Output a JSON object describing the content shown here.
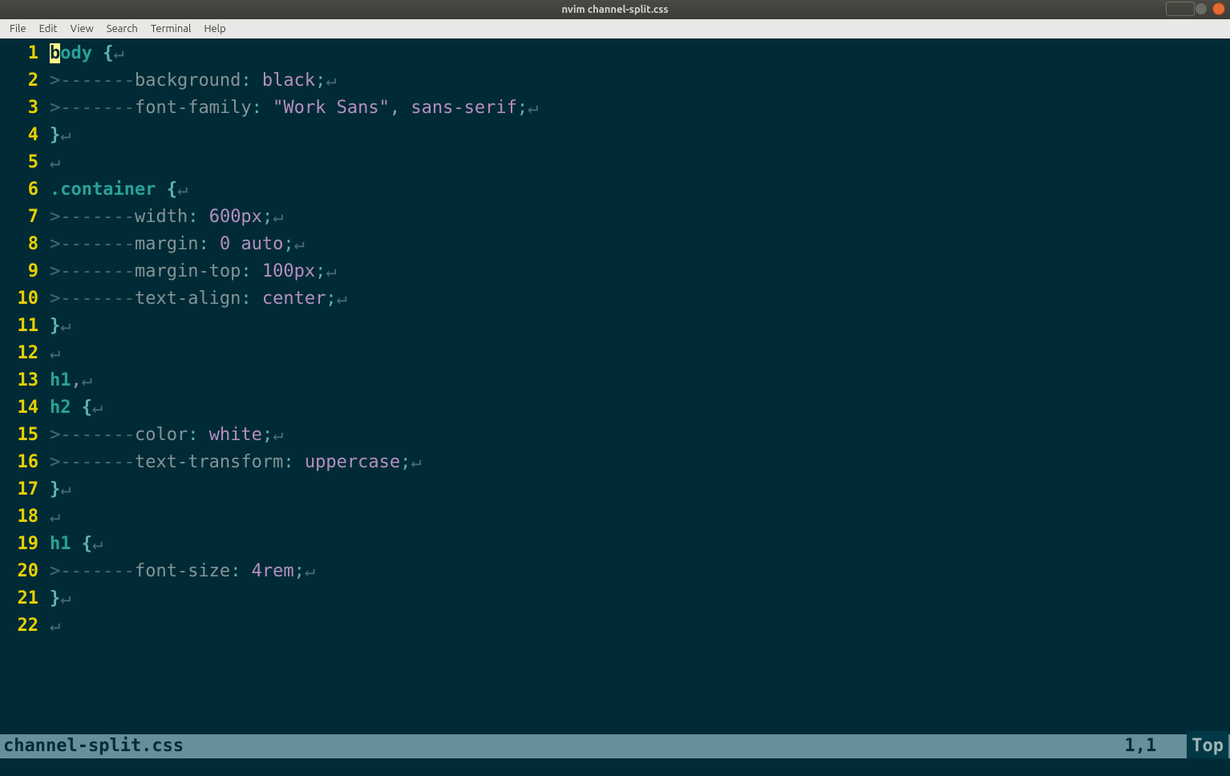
{
  "titlebar": {
    "title": "nvim channel-split.css"
  },
  "menubar": {
    "items": [
      "File",
      "Edit",
      "View",
      "Search",
      "Terminal",
      "Help"
    ]
  },
  "status": {
    "filename": "channel-split.css",
    "position": "1,1",
    "scroll": "Top"
  },
  "glyphs": {
    "indent": ">-------",
    "eol": "↵"
  },
  "code": [
    {
      "n": "1",
      "tokens": [
        {
          "t": "b",
          "c": "cursor"
        },
        {
          "t": "ody ",
          "c": "sel"
        },
        {
          "t": "{",
          "c": "brace"
        },
        {
          "t": "eol"
        }
      ]
    },
    {
      "n": "2",
      "tokens": [
        {
          "t": "indent"
        },
        {
          "t": "background",
          "c": "prop"
        },
        {
          "t": ":",
          "c": "punct"
        },
        {
          "t": " black",
          "c": "val"
        },
        {
          "t": ";",
          "c": "punct"
        },
        {
          "t": "eol"
        }
      ]
    },
    {
      "n": "3",
      "tokens": [
        {
          "t": "indent"
        },
        {
          "t": "font-family",
          "c": "prop"
        },
        {
          "t": ":",
          "c": "punct"
        },
        {
          "t": " \"Work Sans\"",
          "c": "str"
        },
        {
          "t": ",",
          "c": "comma"
        },
        {
          "t": " sans-serif",
          "c": "val"
        },
        {
          "t": ";",
          "c": "punct"
        },
        {
          "t": "eol"
        }
      ]
    },
    {
      "n": "4",
      "tokens": [
        {
          "t": "}",
          "c": "brace"
        },
        {
          "t": "eol"
        }
      ]
    },
    {
      "n": "5",
      "tokens": [
        {
          "t": "eol"
        }
      ]
    },
    {
      "n": "6",
      "tokens": [
        {
          "t": ".container ",
          "c": "sel"
        },
        {
          "t": "{",
          "c": "brace"
        },
        {
          "t": "eol"
        }
      ]
    },
    {
      "n": "7",
      "tokens": [
        {
          "t": "indent"
        },
        {
          "t": "width",
          "c": "prop"
        },
        {
          "t": ":",
          "c": "punct"
        },
        {
          "t": " 600px",
          "c": "val"
        },
        {
          "t": ";",
          "c": "punct"
        },
        {
          "t": "eol"
        }
      ]
    },
    {
      "n": "8",
      "tokens": [
        {
          "t": "indent"
        },
        {
          "t": "margin",
          "c": "prop"
        },
        {
          "t": ":",
          "c": "punct"
        },
        {
          "t": " 0 auto",
          "c": "val"
        },
        {
          "t": ";",
          "c": "punct"
        },
        {
          "t": "eol"
        }
      ]
    },
    {
      "n": "9",
      "tokens": [
        {
          "t": "indent"
        },
        {
          "t": "margin-top",
          "c": "prop"
        },
        {
          "t": ":",
          "c": "punct"
        },
        {
          "t": " 100px",
          "c": "val"
        },
        {
          "t": ";",
          "c": "punct"
        },
        {
          "t": "eol"
        }
      ]
    },
    {
      "n": "10",
      "tokens": [
        {
          "t": "indent"
        },
        {
          "t": "text-align",
          "c": "prop"
        },
        {
          "t": ":",
          "c": "punct"
        },
        {
          "t": " center",
          "c": "val"
        },
        {
          "t": ";",
          "c": "punct"
        },
        {
          "t": "eol"
        }
      ]
    },
    {
      "n": "11",
      "tokens": [
        {
          "t": "}",
          "c": "brace"
        },
        {
          "t": "eol"
        }
      ]
    },
    {
      "n": "12",
      "tokens": [
        {
          "t": "eol"
        }
      ]
    },
    {
      "n": "13",
      "tokens": [
        {
          "t": "h1",
          "c": "sel"
        },
        {
          "t": ",",
          "c": "comma"
        },
        {
          "t": "eol"
        }
      ]
    },
    {
      "n": "14",
      "tokens": [
        {
          "t": "h2 ",
          "c": "sel"
        },
        {
          "t": "{",
          "c": "brace"
        },
        {
          "t": "eol"
        }
      ]
    },
    {
      "n": "15",
      "tokens": [
        {
          "t": "indent"
        },
        {
          "t": "color",
          "c": "prop"
        },
        {
          "t": ":",
          "c": "punct"
        },
        {
          "t": " white",
          "c": "val"
        },
        {
          "t": ";",
          "c": "punct"
        },
        {
          "t": "eol"
        }
      ]
    },
    {
      "n": "16",
      "tokens": [
        {
          "t": "indent"
        },
        {
          "t": "text-transform",
          "c": "prop"
        },
        {
          "t": ":",
          "c": "punct"
        },
        {
          "t": " uppercase",
          "c": "val"
        },
        {
          "t": ";",
          "c": "punct"
        },
        {
          "t": "eol"
        }
      ]
    },
    {
      "n": "17",
      "tokens": [
        {
          "t": "}",
          "c": "brace"
        },
        {
          "t": "eol"
        }
      ]
    },
    {
      "n": "18",
      "tokens": [
        {
          "t": "eol"
        }
      ]
    },
    {
      "n": "19",
      "tokens": [
        {
          "t": "h1 ",
          "c": "sel"
        },
        {
          "t": "{",
          "c": "brace"
        },
        {
          "t": "eol"
        }
      ]
    },
    {
      "n": "20",
      "tokens": [
        {
          "t": "indent"
        },
        {
          "t": "font-size",
          "c": "prop"
        },
        {
          "t": ":",
          "c": "punct"
        },
        {
          "t": " 4rem",
          "c": "val"
        },
        {
          "t": ";",
          "c": "punct"
        },
        {
          "t": "eol"
        }
      ]
    },
    {
      "n": "21",
      "tokens": [
        {
          "t": "}",
          "c": "brace"
        },
        {
          "t": "eol"
        }
      ]
    },
    {
      "n": "22",
      "tokens": [
        {
          "t": "eol"
        }
      ]
    }
  ]
}
